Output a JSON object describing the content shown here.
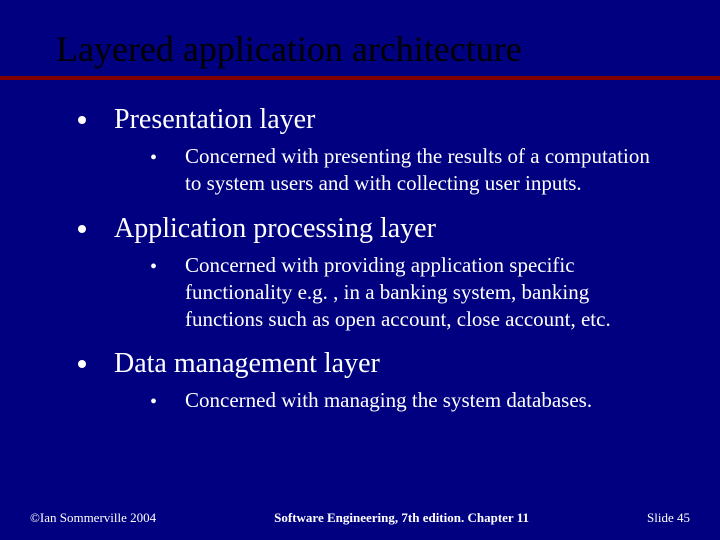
{
  "title": "Layered application architecture",
  "items": [
    {
      "heading": "Presentation layer",
      "sub": "Concerned with presenting the results of a computation to system users and with collecting user inputs."
    },
    {
      "heading": "Application processing layer",
      "sub": "Concerned with providing application specific functionality e.g. , in a banking system, banking functions such as open account, close account, etc."
    },
    {
      "heading": "Data management layer",
      "sub": "Concerned with managing the system databases."
    }
  ],
  "footer": {
    "left": "©Ian Sommerville 2004",
    "center": "Software Engineering, 7th edition. Chapter 11",
    "right": "Slide 45"
  }
}
